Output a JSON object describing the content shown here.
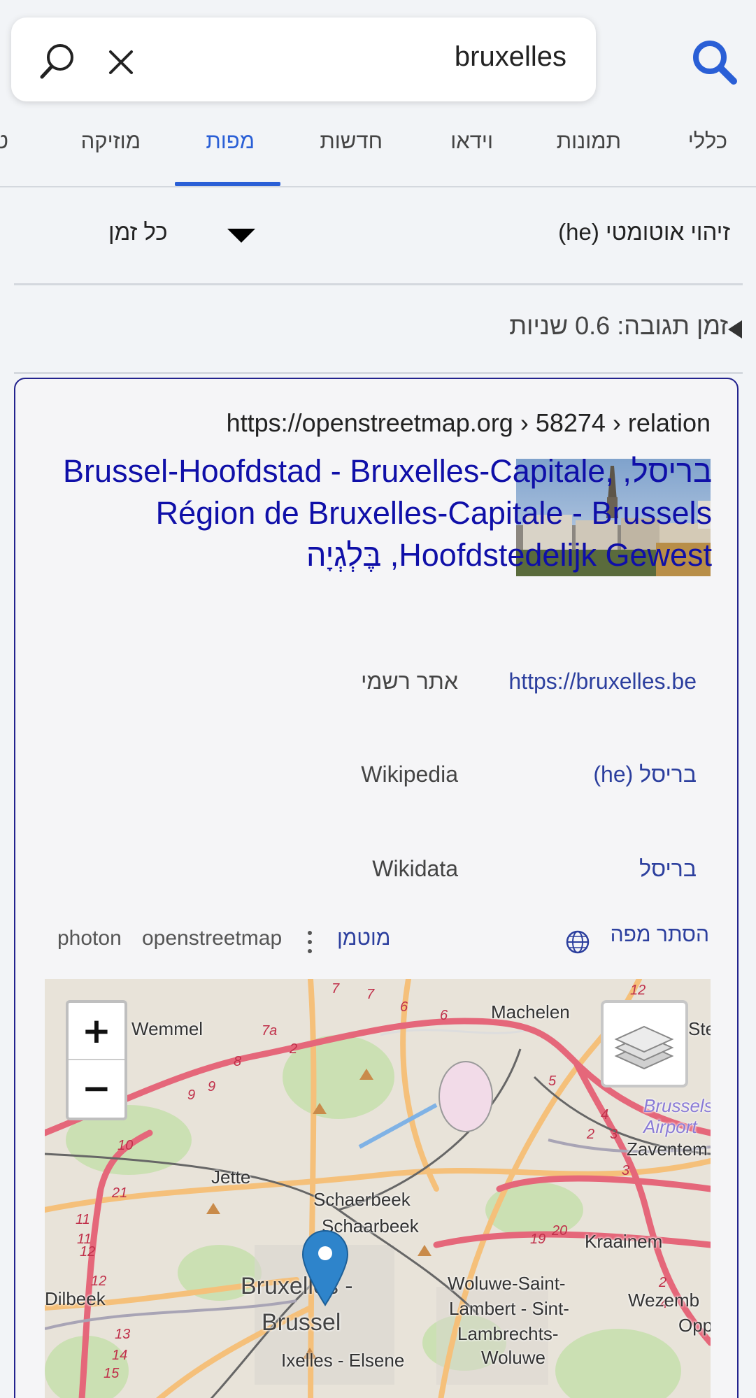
{
  "search": {
    "value": "bruxelles"
  },
  "tabs": [
    {
      "label": "כללי",
      "active": false
    },
    {
      "label": "תמונות",
      "active": false
    },
    {
      "label": "וידאו",
      "active": false
    },
    {
      "label": "חדשות",
      "active": false
    },
    {
      "label": "מפות",
      "active": true
    },
    {
      "label": "מוזיקה",
      "active": false
    },
    {
      "label": "ט",
      "active": false
    }
  ],
  "filters": {
    "language": "זיהוי אוטומטי (he)",
    "time": "כל זמן"
  },
  "response_time": "זמן תגובה: 0.6 שניות",
  "result": {
    "url": "https://openstreetmap.org › 58274 › relation",
    "title": "בריסל, Brussel-Hoofdstad - Bruxelles-Capitale, Région de Bruxelles-Capitale - Brussels Hoofdstedelijk Gewest, בֶּלְגְיָה",
    "info": [
      {
        "label": "אתר רשמי",
        "value": "https://bruxelles.be"
      },
      {
        "label": "Wikipedia",
        "value": "(he) בריסל"
      },
      {
        "label": "Wikidata",
        "value": "בריסל"
      }
    ],
    "map_actions": {
      "hide_map": "הסתר מפה",
      "cached": "מוטמן",
      "engine_osm": "openstreetmap",
      "engine_photon": "photon"
    }
  },
  "map": {
    "zoom_in": "+",
    "zoom_out": "−",
    "labels": {
      "wemmel": "Wemmel",
      "machelen": "Machelen",
      "jette": "Jette",
      "schaerbeek": "Schaerbeek",
      "schaarbeek": "Schaarbeek",
      "zaventem": "Zaventem",
      "kraainem": "Kraainem",
      "bruxelles": "Bruxelles -",
      "brussel": "Brussel",
      "woluwe1": "Woluwe-Saint-",
      "woluwe2": "Lambert - Sint-",
      "woluwe3": "Lambrechts-",
      "woluwe4": "Woluwe",
      "ixelles": "Ixelles - Elsene",
      "airport1": "Brussels",
      "airport2": "Airport",
      "dilbeek": "Dilbeek",
      "wezemb": "Wezemb",
      "oppe": "Oppe",
      "ste": "Ste"
    }
  },
  "colors": {
    "accent": "#2a5fd6",
    "title_link": "#0f0fa8",
    "link": "#2c3f9e",
    "card_border": "#23238e"
  }
}
